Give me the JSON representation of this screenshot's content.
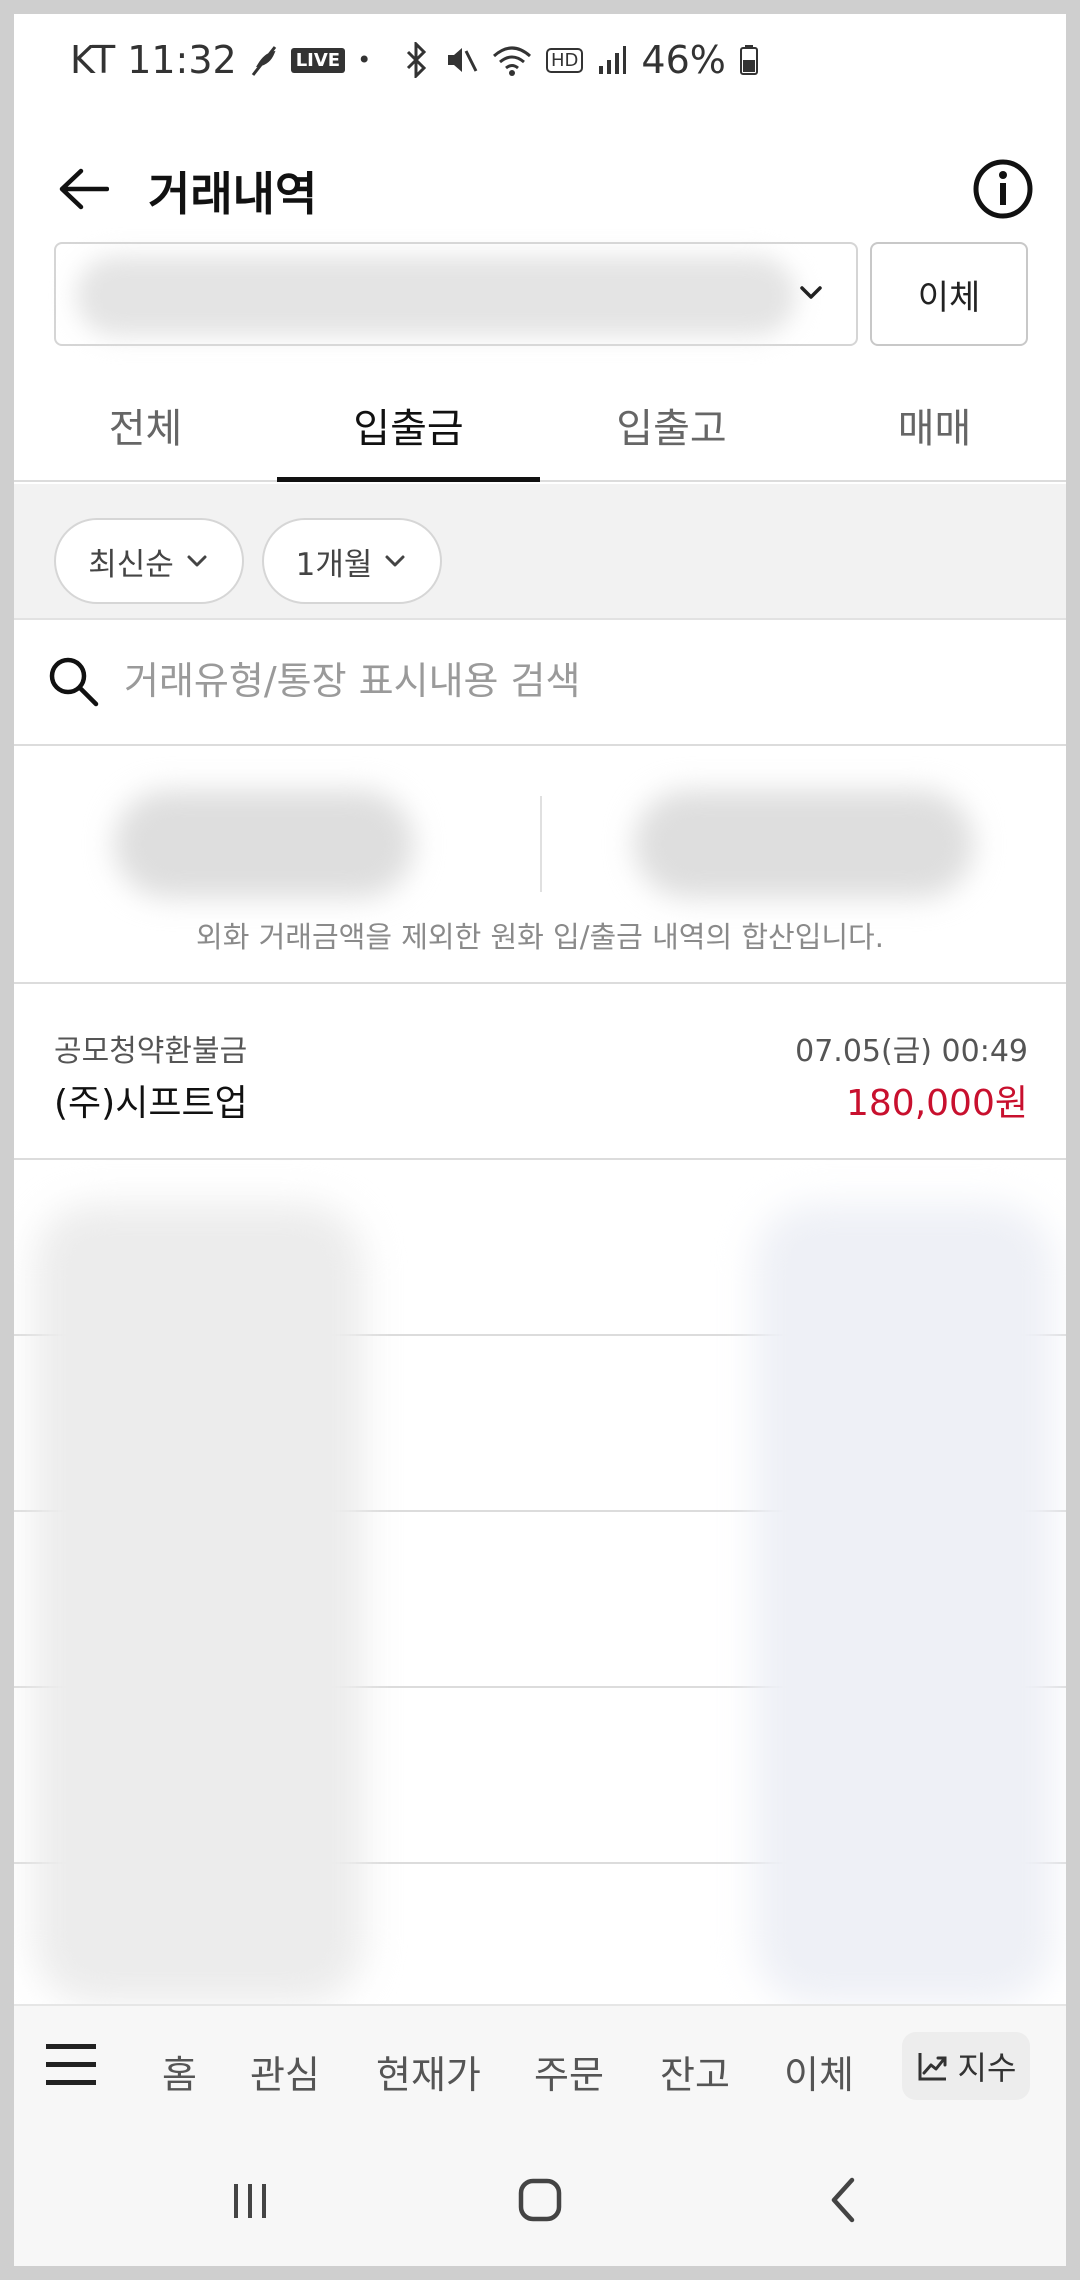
{
  "status_bar": {
    "carrier": "KT",
    "time": "11:32",
    "live_badge": "LIVE",
    "dot": "•",
    "hd_badge": "HD",
    "battery": "46%"
  },
  "header": {
    "title": "거래내역",
    "back_icon": "arrow-left-icon",
    "info_icon": "info-circle-icon"
  },
  "account": {
    "transfer_label": "이체"
  },
  "tabs": [
    {
      "label": "전체",
      "active": false
    },
    {
      "label": "입출금",
      "active": true
    },
    {
      "label": "입출고",
      "active": false
    },
    {
      "label": "매매",
      "active": false
    }
  ],
  "filters": {
    "sort_label": "최신순",
    "period_label": "1개월"
  },
  "search": {
    "placeholder": "거래유형/통장 표시내용 검색"
  },
  "summary": {
    "note": "외화 거래금액을 제외한 원화 입/출금 내역의 합산입니다."
  },
  "transactions": [
    {
      "type": "공모청약환불금",
      "date": "07.05(금) 00:49",
      "name": "(주)시프트업",
      "amount": "180,000원"
    }
  ],
  "bottom_nav": {
    "items": [
      "홈",
      "관심",
      "현재가",
      "주문",
      "잔고",
      "이체"
    ],
    "index_label": "지수"
  },
  "colors": {
    "amount_red": "#c8102e",
    "active_tab": "#111111"
  }
}
